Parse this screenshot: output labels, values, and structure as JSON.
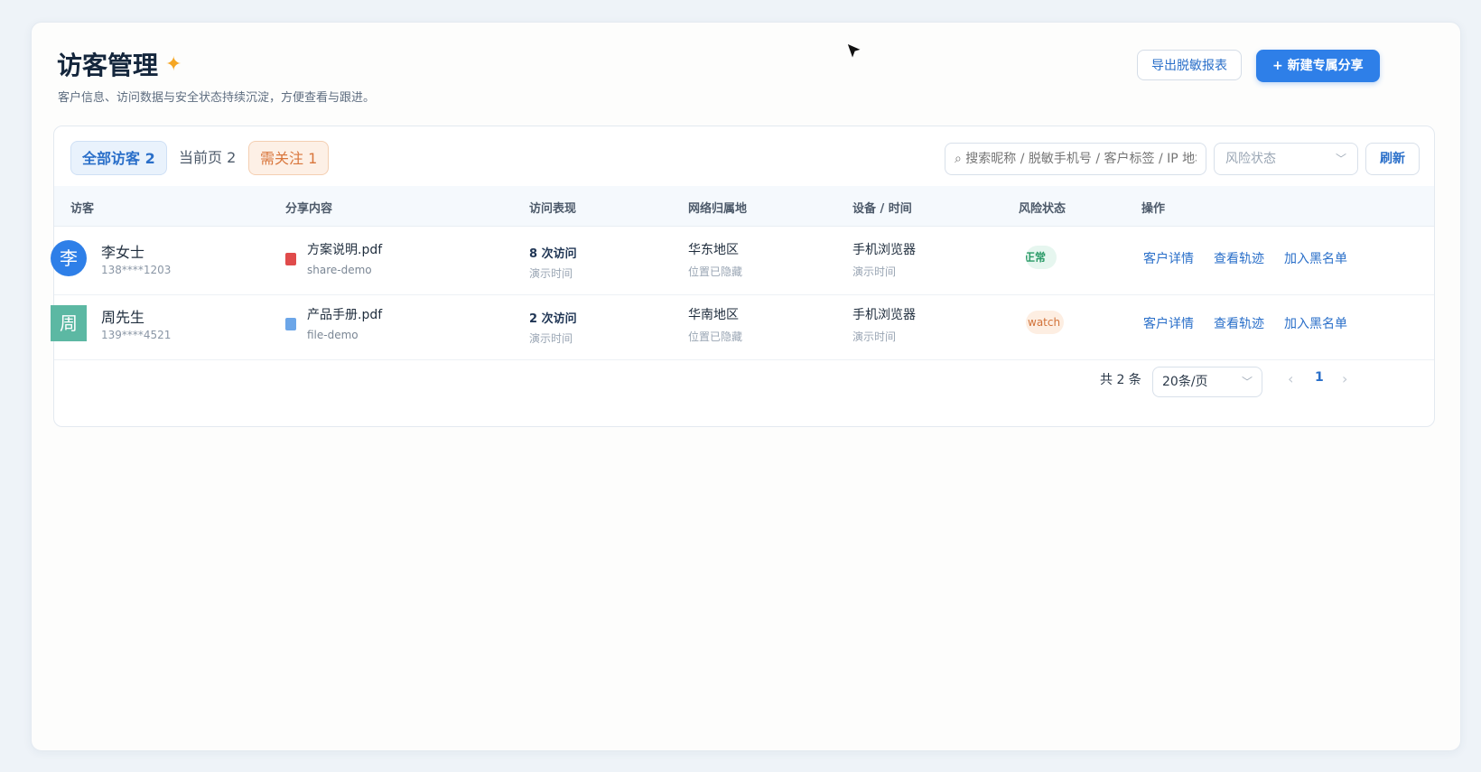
{
  "header": {
    "title": "访客管理",
    "star_icon": "✦",
    "subtitle": "客户信息、访问数据与安全状态持续沉淀，方便查看与跟进。",
    "export_label": "导出脱敏报表",
    "new_share_label": "+ 新建专属分享"
  },
  "filters": {
    "tab_all": "全部访客 2",
    "tab_page": "当前页 2",
    "tab_attention": "需关注 1",
    "search_placeholder": "⌕ 搜索昵称 / 脱敏手机号 / 客户标签 / IP 地址",
    "risk_select": "风险状态",
    "refresh_label": "刷新"
  },
  "table": {
    "columns": [
      "访客",
      "分享内容",
      "访问表现",
      "网络归属地",
      "设备 / 时间",
      "风险状态",
      "操作"
    ],
    "rows": [
      {
        "avatar": "李",
        "name": "李女士",
        "phone": "138****1203",
        "file_icon": "pdf-icon",
        "file": "方案说明.pdf",
        "file_sub": "share-demo",
        "visits": "8 次访问",
        "visits_sub": "演示时间",
        "region": "华东地区",
        "region_sub": "位置已隐藏",
        "device": "手机浏览器",
        "device_sub": "演示时间",
        "risk": "正常",
        "actions": [
          "客户详情",
          "查看轨迹",
          "加入黑名单"
        ]
      },
      {
        "avatar": "周",
        "name": "周先生",
        "phone": "139****4521",
        "file_icon": "image-icon",
        "file": "产品手册.pdf",
        "file_sub": "file-demo",
        "visits": "2 次访问",
        "visits_sub": "演示时间",
        "region": "华南地区",
        "region_sub": "位置已隐藏",
        "device": "手机浏览器",
        "device_sub": "演示时间",
        "risk": "watch",
        "actions": [
          "客户详情",
          "查看轨迹",
          "加入黑名单"
        ]
      }
    ]
  },
  "pagination": {
    "total": "共 2 条",
    "page_size": "20条/页",
    "prev": "‹",
    "current": "1",
    "next": "›"
  },
  "colors": {
    "primary": "#2e7fe8",
    "ok": "#2a9a67",
    "watch": "#d2733a"
  }
}
